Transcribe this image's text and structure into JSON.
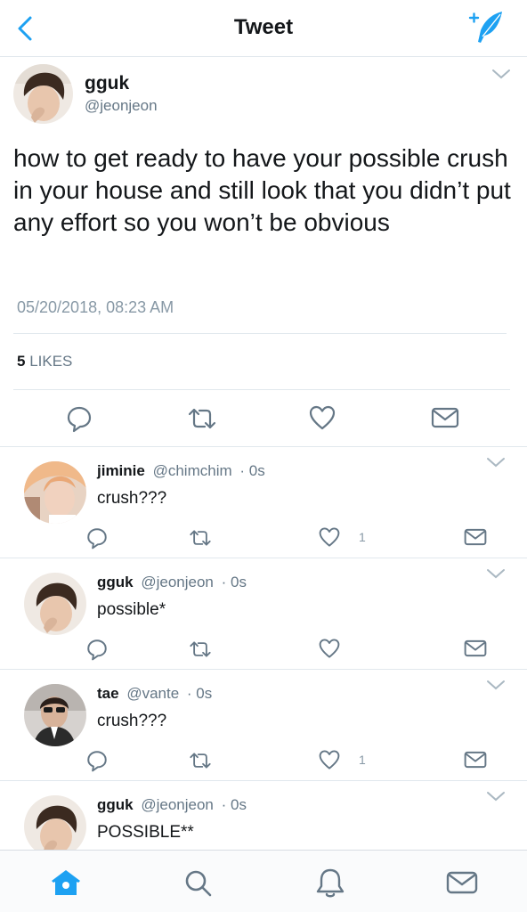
{
  "header": {
    "title": "Tweet",
    "back_icon": "chevron-left-icon",
    "compose_icon": "compose-feather-icon",
    "accent": "#1da1f2"
  },
  "main_tweet": {
    "name": "gguk",
    "handle": "@jeonjeon",
    "text": "how to get ready to have your possible crush in your house and still look that you didn’t put any effort so you won’t be obvious",
    "timestamp": "05/20/2018, 08:23 AM",
    "likes_count": "5",
    "likes_label": "LIKES"
  },
  "replies": [
    {
      "name": "jiminie",
      "handle": "@chimchim",
      "time": "· 0s",
      "text": "crush???",
      "like_count": "1"
    },
    {
      "name": "gguk",
      "handle": "@jeonjeon",
      "time": "· 0s",
      "text": "possible*",
      "like_count": ""
    },
    {
      "name": "tae",
      "handle": "@vante",
      "time": "· 0s",
      "text": "crush???",
      "like_count": "1"
    },
    {
      "name": "gguk",
      "handle": "@jeonjeon",
      "time": "· 0s",
      "text": "POSSIBLE**",
      "like_count": ""
    }
  ],
  "tabbar": {
    "items": [
      "home-icon",
      "search-icon",
      "notifications-bell-icon",
      "messages-envelope-icon"
    ],
    "active": "home-icon"
  }
}
